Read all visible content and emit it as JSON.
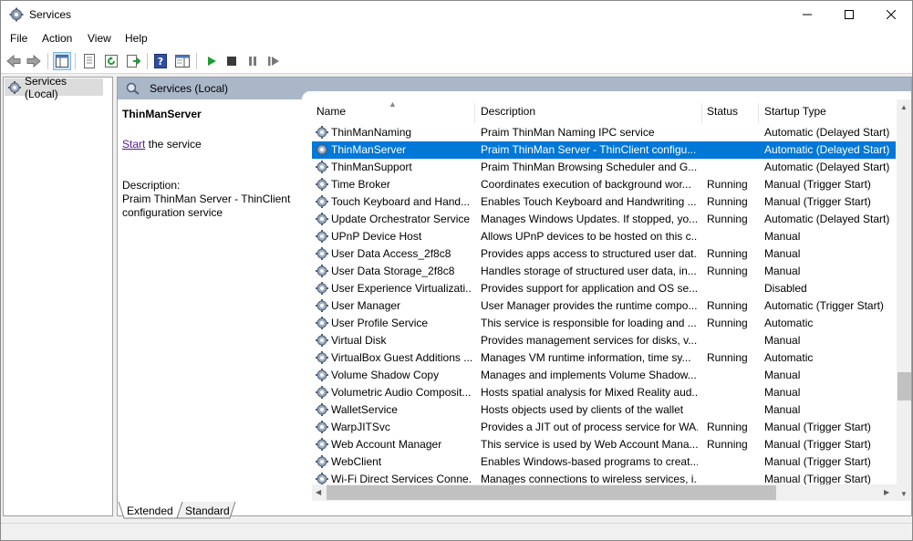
{
  "window": {
    "title": "Services"
  },
  "menu": [
    "File",
    "Action",
    "View",
    "Help"
  ],
  "tree": {
    "root_label": "Services (Local)"
  },
  "content_header": {
    "label": "Services (Local)"
  },
  "detail": {
    "service_name": "ThinManServer",
    "start_link": "Start",
    "start_suffix": " the service",
    "description_label": "Description:",
    "description_text": "Praim ThinMan Server - ThinClient configuration service"
  },
  "columns": {
    "name": "Name",
    "description": "Description",
    "status": "Status",
    "startup": "Startup Type"
  },
  "services": [
    {
      "name": "ThinManNaming",
      "desc": "Praim ThinMan Naming IPC service",
      "status": "",
      "startup": "Automatic (Delayed Start)"
    },
    {
      "name": "ThinManServer",
      "desc": "Praim ThinMan Server - ThinClient configu...",
      "status": "",
      "startup": "Automatic (Delayed Start)",
      "selected": true
    },
    {
      "name": "ThinManSupport",
      "desc": "Praim ThinMan Browsing Scheduler and G...",
      "status": "",
      "startup": "Automatic (Delayed Start)"
    },
    {
      "name": "Time Broker",
      "desc": "Coordinates execution of background wor...",
      "status": "Running",
      "startup": "Manual (Trigger Start)"
    },
    {
      "name": "Touch Keyboard and Hand...",
      "desc": "Enables Touch Keyboard and Handwriting ...",
      "status": "Running",
      "startup": "Manual (Trigger Start)"
    },
    {
      "name": "Update Orchestrator Service",
      "desc": "Manages Windows Updates. If stopped, yo...",
      "status": "Running",
      "startup": "Automatic (Delayed Start)"
    },
    {
      "name": "UPnP Device Host",
      "desc": "Allows UPnP devices to be hosted on this c...",
      "status": "",
      "startup": "Manual"
    },
    {
      "name": "User Data Access_2f8c8",
      "desc": "Provides apps access to structured user dat...",
      "status": "Running",
      "startup": "Manual"
    },
    {
      "name": "User Data Storage_2f8c8",
      "desc": "Handles storage of structured user data, in...",
      "status": "Running",
      "startup": "Manual"
    },
    {
      "name": "User Experience Virtualizati...",
      "desc": "Provides support for application and OS se...",
      "status": "",
      "startup": "Disabled"
    },
    {
      "name": "User Manager",
      "desc": "User Manager provides the runtime compo...",
      "status": "Running",
      "startup": "Automatic (Trigger Start)"
    },
    {
      "name": "User Profile Service",
      "desc": "This service is responsible for loading and ...",
      "status": "Running",
      "startup": "Automatic"
    },
    {
      "name": "Virtual Disk",
      "desc": "Provides management services for disks, v...",
      "status": "",
      "startup": "Manual"
    },
    {
      "name": "VirtualBox Guest Additions ...",
      "desc": "Manages VM runtime information, time sy...",
      "status": "Running",
      "startup": "Automatic"
    },
    {
      "name": "Volume Shadow Copy",
      "desc": "Manages and implements Volume Shadow...",
      "status": "",
      "startup": "Manual"
    },
    {
      "name": "Volumetric Audio Composit...",
      "desc": "Hosts spatial analysis for Mixed Reality aud...",
      "status": "",
      "startup": "Manual"
    },
    {
      "name": "WalletService",
      "desc": "Hosts objects used by clients of the wallet",
      "status": "",
      "startup": "Manual"
    },
    {
      "name": "WarpJITSvc",
      "desc": "Provides a JIT out of process service for WA...",
      "status": "Running",
      "startup": "Manual (Trigger Start)"
    },
    {
      "name": "Web Account Manager",
      "desc": "This service is used by Web Account Mana...",
      "status": "Running",
      "startup": "Manual (Trigger Start)"
    },
    {
      "name": "WebClient",
      "desc": "Enables Windows-based programs to creat...",
      "status": "",
      "startup": "Manual (Trigger Start)"
    },
    {
      "name": "Wi-Fi Direct Services Conne...",
      "desc": "Manages connections to wireless services, i...",
      "status": "",
      "startup": "Manual (Trigger Start)"
    }
  ],
  "tabs": {
    "extended": "Extended",
    "standard": "Standard"
  },
  "colors": {
    "selection": "#0078d7",
    "header_band": "#aab7c9",
    "play_green": "#1e9c2e"
  }
}
